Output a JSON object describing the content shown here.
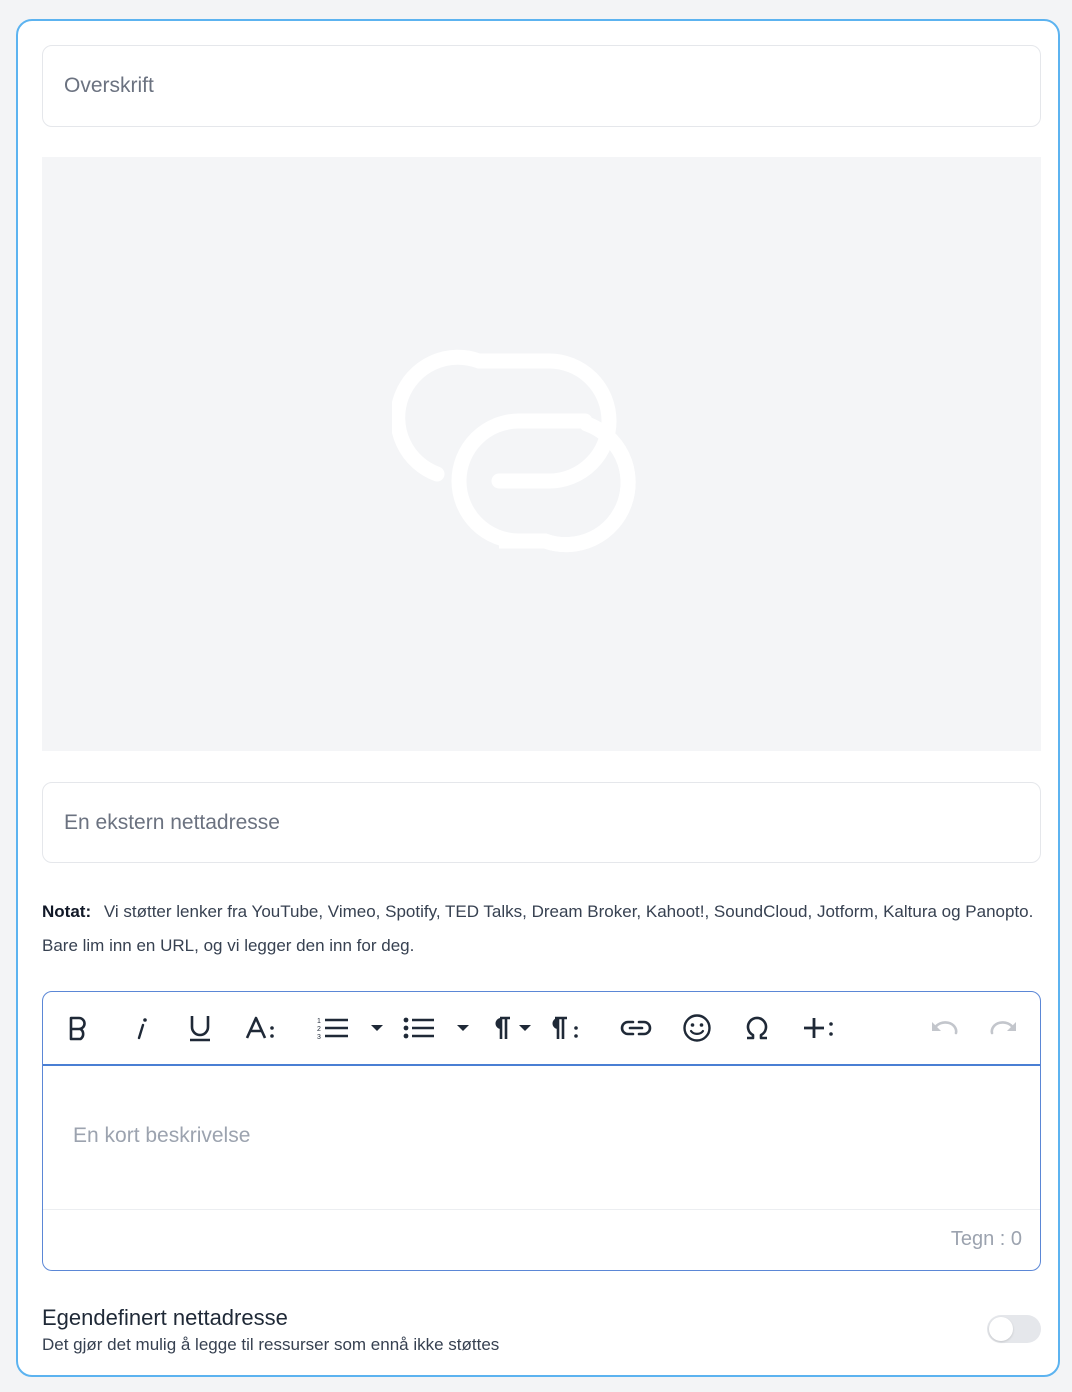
{
  "form": {
    "title_placeholder": "Overskrift",
    "url_placeholder": "En ekstern nettadresse"
  },
  "note": {
    "label": "Notat:",
    "text": "Vi støtter lenker fra YouTube, Vimeo, Spotify, TED Talks, Dream Broker, Kahoot!, SoundCloud, Jotform, Kaltura og Panopto. Bare lim inn en URL, og vi legger den inn for deg."
  },
  "editor": {
    "placeholder": "En kort beskrivelse",
    "counter": "Tegn : 0",
    "toolbar": [
      "bold",
      "italic",
      "underline",
      "font-size",
      "ordered-list",
      "bullet-list",
      "paragraph-format",
      "paragraph-style",
      "insert-link",
      "emoticons",
      "special-characters",
      "more",
      "undo",
      "redo"
    ]
  },
  "custom_url": {
    "title": "Egendefinert nettadresse",
    "description": "Det gjør det mulig å legge til ressurser som ennå ikke støttes",
    "enabled": false
  },
  "colors": {
    "card_border": "#5cb3f0",
    "editor_accent": "#4a7fd4",
    "preview_bg": "#f4f5f7"
  }
}
